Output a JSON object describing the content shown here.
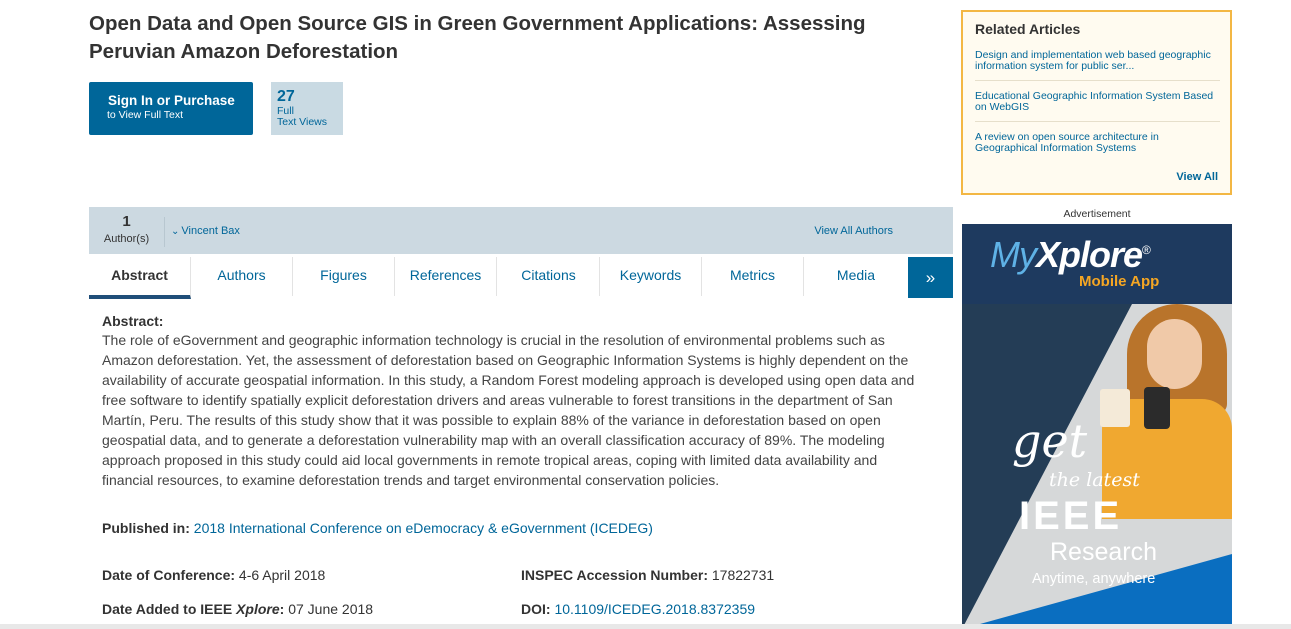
{
  "title": "Open Data and Open Source GIS in Green Government Applications: Assessing Peruvian Amazon Deforestation",
  "signin": {
    "main": "Sign In or Purchase",
    "sub": "to View Full Text"
  },
  "views": {
    "count": "27",
    "label1": "Full",
    "label2": "Text Views"
  },
  "authors": {
    "count": "1",
    "count_label": "Author(s)",
    "first_author": "Vincent Bax",
    "view_all": "View All Authors"
  },
  "tabs": [
    "Abstract",
    "Authors",
    "Figures",
    "References",
    "Citations",
    "Keywords",
    "Metrics",
    "Media"
  ],
  "tab_more": "»",
  "abstract": {
    "heading": "Abstract:",
    "text": "The role of eGovernment and geographic information technology is crucial in the resolution of environmental problems such as Amazon deforestation. Yet, the assessment of deforestation based on Geographic Information Systems is highly dependent on the availability of accurate geospatial information. In this study, a Random Forest modeling approach is developed using open data and free software to identify spatially explicit deforestation drivers and areas vulnerable to forest transitions in the department of San Martín, Peru. The results of this study show that it was possible to explain 88% of the variance in deforestation based on open geospatial data, and to generate a deforestation vulnerability map with an overall classification accuracy of 89%. The modeling approach proposed in this study could aid local governments in remote tropical areas, coping with limited data availability and financial resources, to examine deforestation trends and target environmental conservation policies."
  },
  "meta": {
    "published_in_label": "Published in:",
    "published_in_value": "2018 International Conference on eDemocracy & eGovernment (ICEDEG)",
    "date_conf_label": "Date of Conference:",
    "date_conf_value": "4-6 April 2018",
    "date_added_label_pre": "Date Added to IEEE ",
    "date_added_label_italic": "Xplore",
    "date_added_label_post": ":",
    "date_added_value": "07 June 2018",
    "inspec_label": "INSPEC Accession Number:",
    "inspec_value": "17822731",
    "doi_label": "DOI:",
    "doi_value": "10.1109/ICEDEG.2018.8372359"
  },
  "related": {
    "title": "Related Articles",
    "items": [
      "Design and implementation web based geographic information system for public ser...",
      "Educational Geographic Information System Based on WebGIS",
      "A review on open source architecture in Geographical Information Systems"
    ],
    "view_all": "View All"
  },
  "ad": {
    "label": "Advertisement",
    "brand_my": "My",
    "brand_xplore": "Xplore",
    "brand_reg": "®",
    "mobile_app": "Mobile App",
    "get": "get",
    "the_latest": "the latest",
    "ieee": "IEEE",
    "research": "Research",
    "tagline": "Anytime, anywhere"
  },
  "colors": {
    "link": "#006699",
    "accent_border": "#f3b744",
    "author_bar": "#ccd9e1"
  }
}
